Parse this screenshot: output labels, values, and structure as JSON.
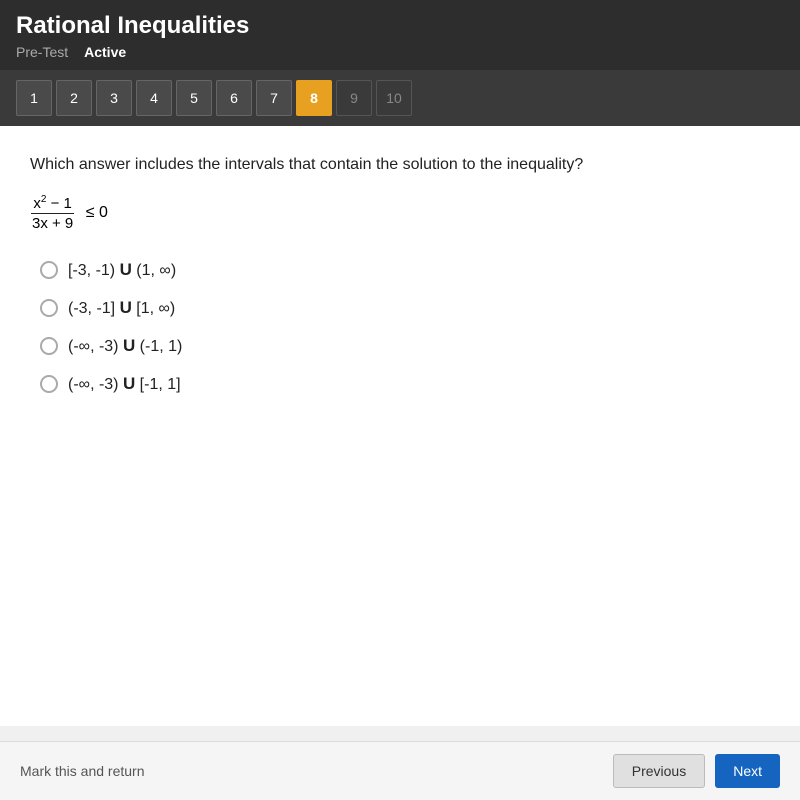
{
  "header": {
    "title": "Rational Inequalities",
    "pre_test_label": "Pre-Test",
    "active_label": "Active"
  },
  "nav": {
    "buttons": [
      {
        "number": "1",
        "state": "normal"
      },
      {
        "number": "2",
        "state": "normal"
      },
      {
        "number": "3",
        "state": "normal"
      },
      {
        "number": "4",
        "state": "normal"
      },
      {
        "number": "5",
        "state": "normal"
      },
      {
        "number": "6",
        "state": "normal"
      },
      {
        "number": "7",
        "state": "normal"
      },
      {
        "number": "8",
        "state": "active"
      },
      {
        "number": "9",
        "state": "disabled"
      },
      {
        "number": "10",
        "state": "disabled"
      }
    ]
  },
  "question": {
    "text": "Which answer includes the intervals that contain the solution to the inequality?",
    "inequality": {
      "numerator": "x² - 1",
      "denominator": "3x + 9",
      "symbol": "≤ 0"
    },
    "options": [
      {
        "id": "a",
        "text": "[-3, -1) ∪ (1, ∞)"
      },
      {
        "id": "b",
        "text": "(-3, -1] ∪ [1, ∞)"
      },
      {
        "id": "c",
        "text": "(-∞, -3) ∪ (-1, 1)"
      },
      {
        "id": "d",
        "text": "(-∞, -3) ∪ [-1, 1]"
      }
    ]
  },
  "bottom": {
    "mark_return_label": "Mark this and return",
    "prev_label": "Previous",
    "next_label": "Next"
  }
}
